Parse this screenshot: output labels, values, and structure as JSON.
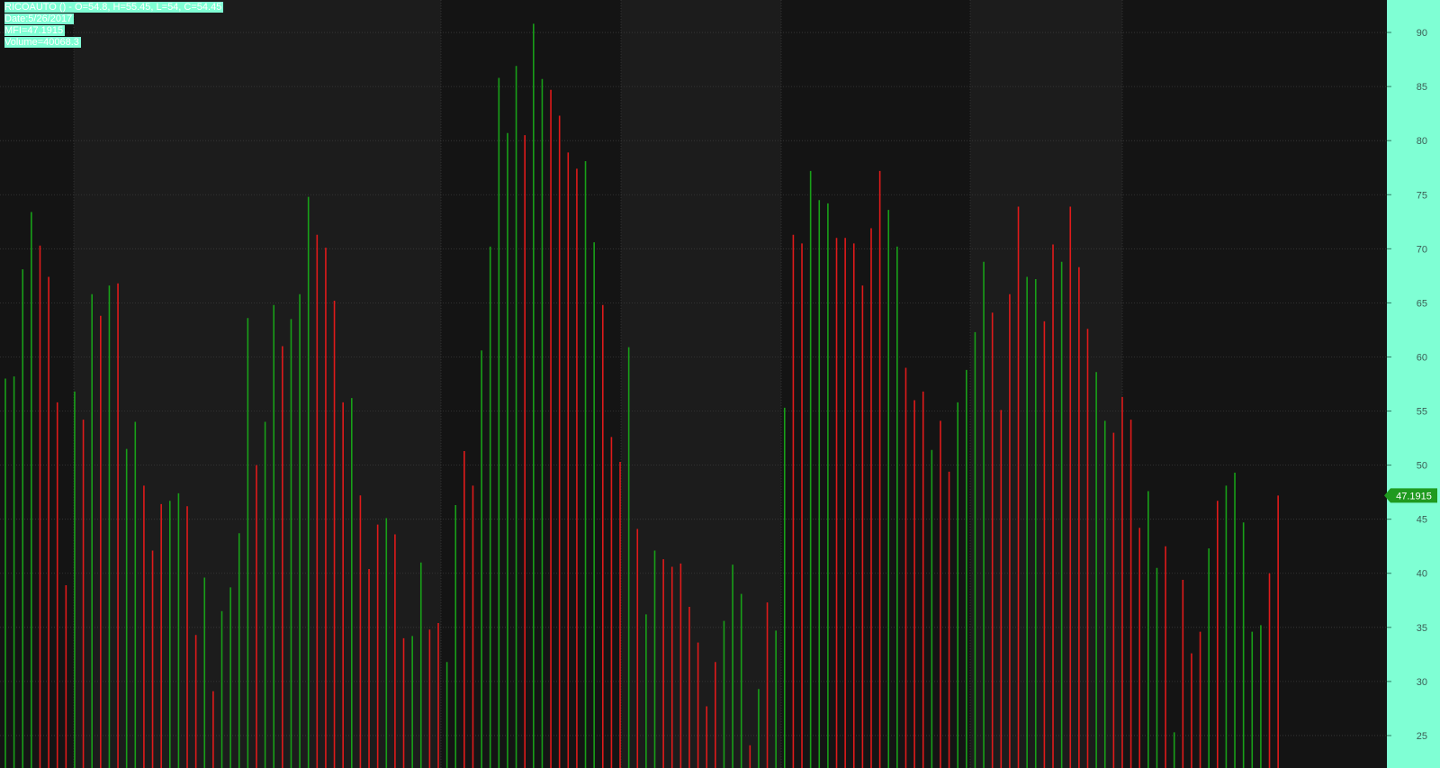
{
  "header": {
    "ohlc_line": "RICOAUTO ()  -  O=54.8, H=55.45, L=54, C=54.45",
    "date_line": "Date:5/26/2017",
    "mfi_line": " MFI=47.1915",
    "volume_line": " Volume=40068.3"
  },
  "last_value_label": "47.1915",
  "colors": {
    "up": "#18a018",
    "down": "#e01a1a",
    "axis_panel": "#7fffd4",
    "last_value_badge": "#1f9a1f",
    "background": "#141414",
    "band": "#1c1c1c"
  },
  "chart_data": {
    "type": "bar",
    "indicator": "MFI",
    "ylim": [
      22,
      93
    ],
    "yticks": [
      25,
      30,
      35,
      40,
      45,
      50,
      55,
      60,
      65,
      70,
      75,
      80,
      85,
      90
    ],
    "grid": true,
    "series": [
      {
        "values": [
          58,
          58.2,
          68.1,
          73.4,
          70.3,
          67.4,
          55.8,
          38.9,
          56.8,
          54.2,
          65.8,
          63.8,
          66.6,
          66.8,
          51.5,
          54,
          48.1,
          42.1,
          46.4,
          46.7,
          47.4,
          46.2,
          34.3,
          39.6,
          29.1,
          36.5,
          38.7,
          43.7,
          63.6,
          50,
          54,
          64.8,
          61,
          63.5,
          65.8,
          74.8,
          71.3,
          70.1,
          65.2,
          55.8,
          56.2,
          47.2,
          40.4,
          44.5,
          45.1,
          43.6,
          34,
          34.2,
          41,
          34.8,
          35.4,
          31.8,
          46.3,
          51.3,
          48.1,
          60.6,
          70.2,
          85.8,
          80.7,
          86.9,
          80.5,
          90.8,
          85.7,
          84.7,
          82.3,
          78.9,
          77.4,
          78.1,
          70.6,
          64.8,
          52.6,
          50.3,
          60.9,
          44.1,
          36.2,
          42.1,
          41.3,
          40.6,
          40.9,
          36.9,
          33.6,
          27.7,
          31.8,
          35.6,
          40.8,
          38.1,
          24.1,
          29.3,
          37.3,
          34.7,
          55.3,
          71.3,
          70.5,
          77.2,
          74.5,
          74.2,
          71,
          71,
          70.5,
          66.6,
          71.9,
          77.2,
          73.6,
          70.2,
          59,
          56,
          56.8,
          51.4,
          54.1,
          49.4,
          55.8,
          58.8,
          62.3,
          68.8,
          64.1,
          55.1,
          65.8,
          73.9,
          67.4,
          67.2,
          63.3,
          70.4,
          68.8,
          73.9,
          68.3,
          62.6,
          58.6,
          54.1,
          53,
          56.3,
          54.2,
          44.2,
          47.6,
          40.5,
          42.5,
          25.3,
          39.4,
          32.6,
          34.6,
          42.3,
          46.7,
          48.1,
          49.3,
          44.7,
          34.6,
          35.2,
          40,
          47.19
        ],
        "directions": "uuuuddddudududuuddduudduduuuuduuduuuddddudddudduudduudduuuuuduudddduuddduduuddddddduuududuudduuudddddduudddudduuuudddduudduddduudddduududdduduuuuuddduu"
      }
    ]
  }
}
